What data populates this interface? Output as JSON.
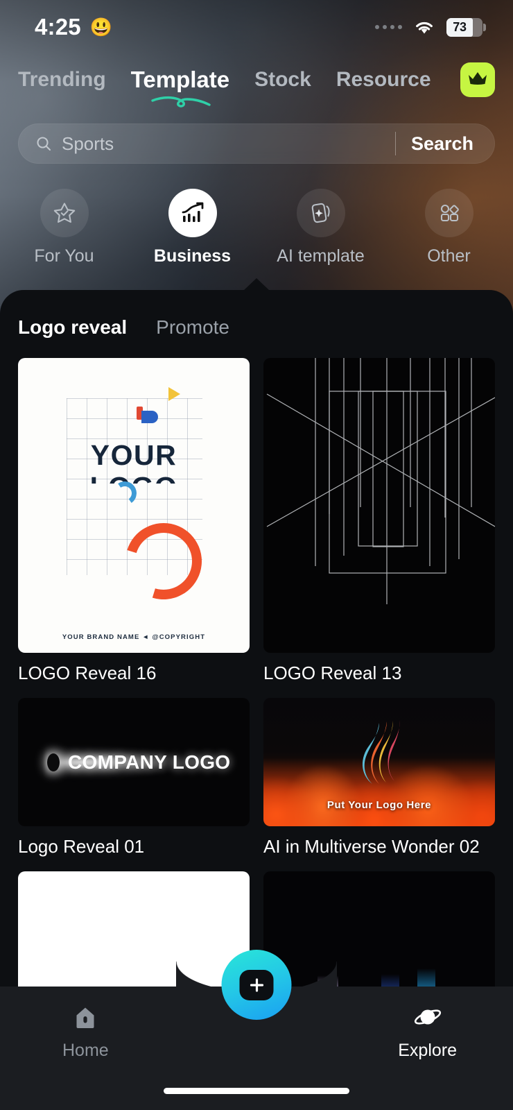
{
  "status_bar": {
    "time": "4:25",
    "emoji": "😃",
    "battery_percent": "73",
    "wifi_icon": "wifi-icon",
    "signal_dots_icon": "signal-dots-icon",
    "battery_icon": "battery-icon"
  },
  "top_tabs": {
    "items": [
      {
        "label": "Trending",
        "active": false
      },
      {
        "label": "Template",
        "active": true
      },
      {
        "label": "Stock",
        "active": false
      },
      {
        "label": "Resource",
        "active": false
      }
    ],
    "premium_icon": "crown-icon",
    "premium_color": "#c6f542",
    "active_underline_color": "#2fd0a8"
  },
  "search": {
    "placeholder": "Sports",
    "value": "",
    "button_label": "Search",
    "icon": "search-icon"
  },
  "categories": [
    {
      "label": "For You",
      "icon": "star-check-icon",
      "active": false
    },
    {
      "label": "Business",
      "icon": "chart-growth-icon",
      "active": true
    },
    {
      "label": "AI template",
      "icon": "ai-cards-sparkle-icon",
      "active": false
    },
    {
      "label": "Other",
      "icon": "grid-shapes-icon",
      "active": false
    }
  ],
  "sub_tabs": [
    {
      "label": "Logo reveal",
      "active": true
    },
    {
      "label": "Promote",
      "active": false
    }
  ],
  "templates": [
    {
      "title": "LOGO Reveal 16",
      "thumb_style": "paper-logo",
      "thumb_text_main": "YOUR",
      "thumb_text_second": "LOGO",
      "thumb_footer": "YOUR BRAND NAME ◄ @COPYRIGHT"
    },
    {
      "title": "LOGO Reveal 13",
      "thumb_style": "geometric-lines"
    },
    {
      "title": "Logo Reveal 01",
      "thumb_style": "beam-logo",
      "thumb_text_main": "COMPANY LOGO"
    },
    {
      "title": "AI in Multiverse Wonder 02",
      "thumb_style": "fire-flame",
      "thumb_text_main": "Put Your Logo Here"
    },
    {
      "title": "",
      "thumb_style": "white-blank"
    },
    {
      "title": "",
      "thumb_style": "dark-bars"
    }
  ],
  "bottom_nav": {
    "items": [
      {
        "label": "Home",
        "icon": "home-icon",
        "active": false
      },
      {
        "label": "Explore",
        "icon": "planet-icon",
        "active": true
      }
    ],
    "create_button": {
      "icon": "plus-icon",
      "gradient_from": "#29e6d8",
      "gradient_to": "#1a9ff2"
    }
  }
}
